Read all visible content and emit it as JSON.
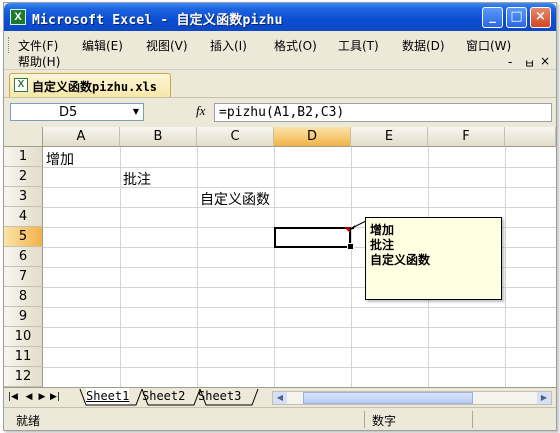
{
  "window": {
    "title": "Microsoft Excel - 自定义函数pizhu",
    "app_icon": "excel-icon",
    "min_glyph": "_",
    "max_glyph": "□",
    "close_glyph": "×"
  },
  "menu": {
    "items": [
      "文件(F)",
      "编辑(E)",
      "视图(V)",
      "插入(I)",
      "格式(O)",
      "工具(T)",
      "数据(D)",
      "窗口(W)"
    ],
    "help": "帮助(H)",
    "min_glyph": "-",
    "restore_glyph": "ㅂ",
    "close_glyph": "×"
  },
  "workbook_tab": {
    "label": "自定义函数pizhu.xls"
  },
  "formula_bar": {
    "name_box": "D5",
    "fx": "fx",
    "formula": "=pizhu(A1,B2,C3)"
  },
  "grid": {
    "columns": [
      "A",
      "B",
      "C",
      "D",
      "E",
      "F"
    ],
    "rows": [
      "1",
      "2",
      "3",
      "4",
      "5",
      "6",
      "7",
      "8",
      "9",
      "10",
      "11",
      "12"
    ],
    "active_cell": "D5",
    "cells": {
      "A1": "增加",
      "B2": "批注",
      "C3": "自定义函数"
    }
  },
  "comment": {
    "lines": [
      "增加",
      "批注",
      "自定义函数"
    ]
  },
  "sheet_tabs": {
    "nav": [
      "|◀",
      "◀",
      "▶",
      "▶|"
    ],
    "tabs": [
      "Sheet1",
      "Sheet2",
      "Sheet3"
    ],
    "active": "Sheet1"
  },
  "status_bar": {
    "left": "就绪",
    "mode": "数字"
  },
  "colors": {
    "titlebar": "#0a4ed3",
    "active_header": "#f2b24a",
    "comment_bg": "#ffffe1",
    "comment_indicator": "#c00000"
  }
}
